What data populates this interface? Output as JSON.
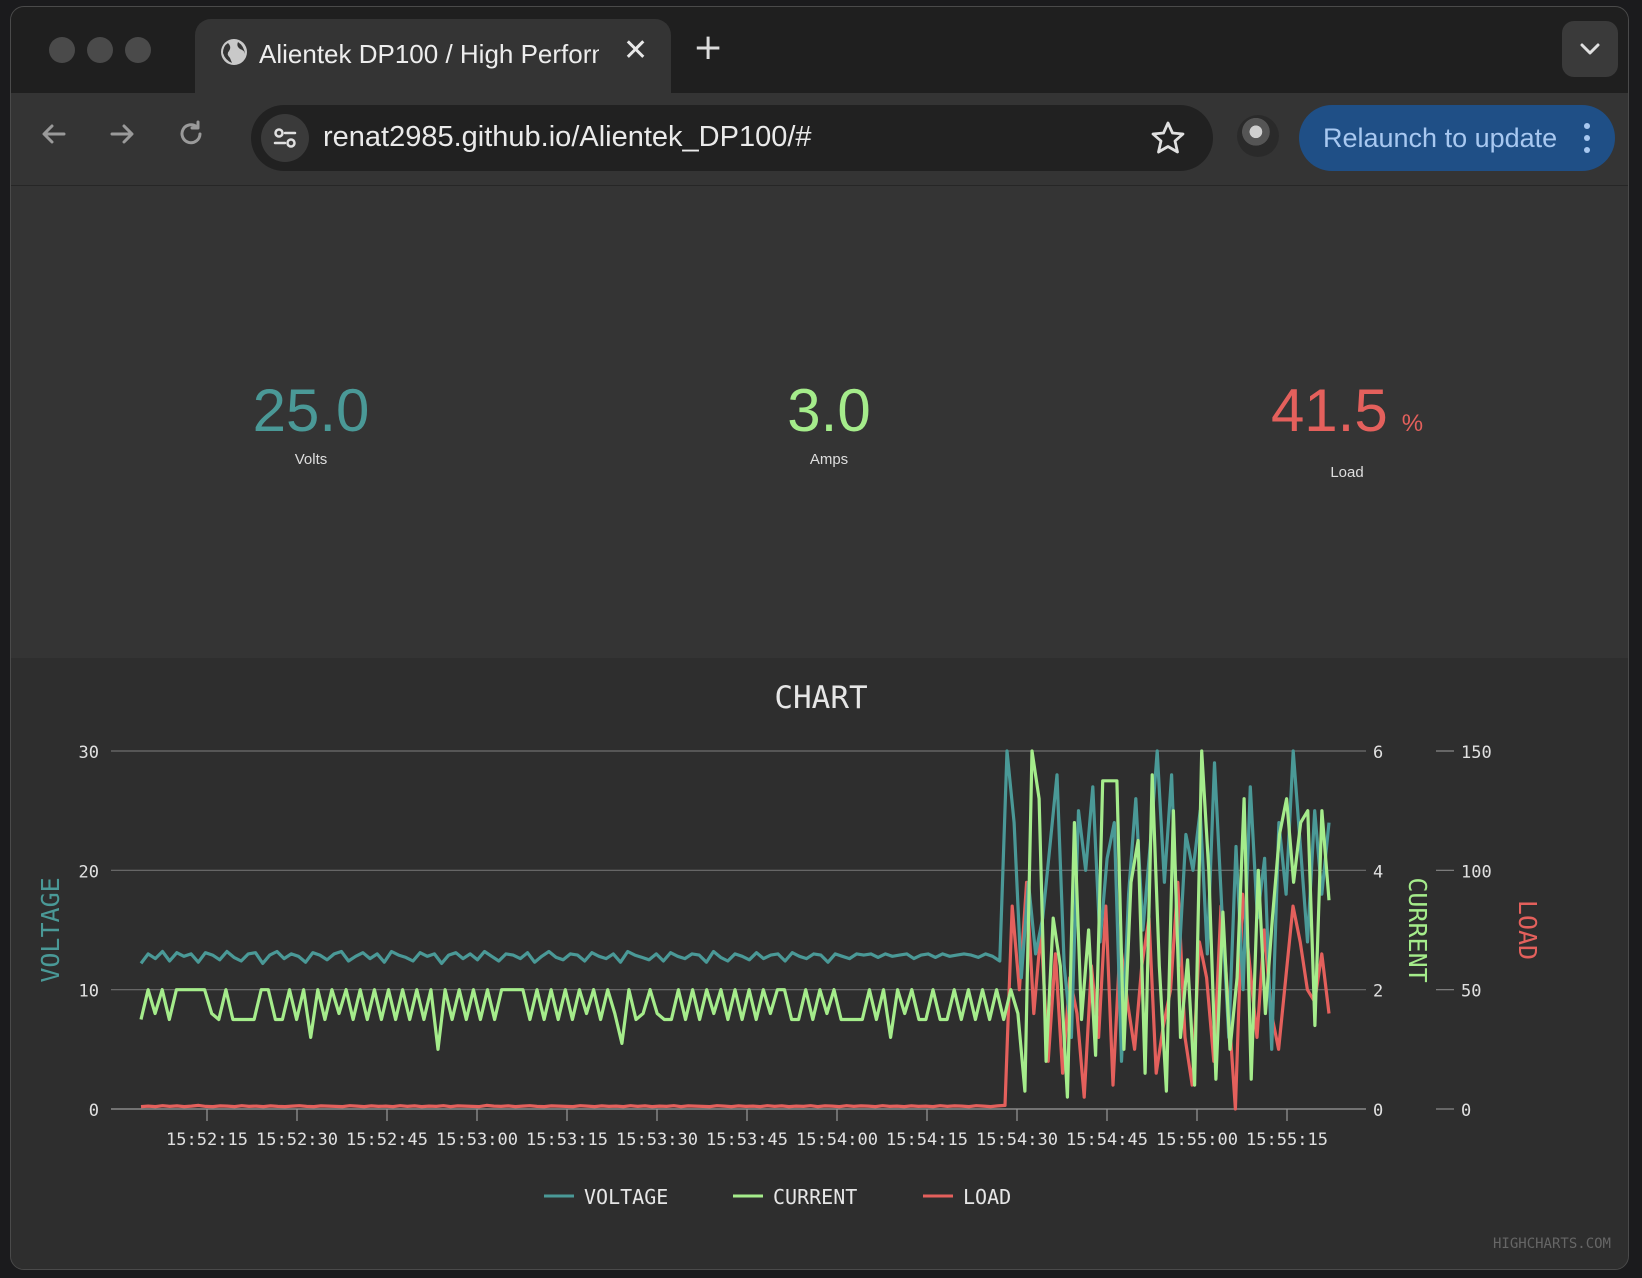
{
  "browser": {
    "tab_title": "Alientek DP100 / High Perform",
    "url": "renat2985.github.io/Alientek_DP100/#",
    "relaunch_label": "Relaunch to update"
  },
  "stats": {
    "voltage": {
      "value": "25.0",
      "label": "Volts"
    },
    "current": {
      "value": "3.0",
      "label": "Amps"
    },
    "load": {
      "value": "41.5",
      "unit": "%",
      "label": "Load"
    }
  },
  "colors": {
    "voltage": "#4a9997",
    "current": "#a5ec8b",
    "load": "#e4605c"
  },
  "chart_data": {
    "type": "line",
    "title": "CHART",
    "credit": "HIGHCHARTS.COM",
    "legend_position": "bottom",
    "grid": true,
    "x_tick_labels": [
      "15:52:15",
      "15:52:30",
      "15:52:45",
      "15:53:00",
      "15:53:15",
      "15:53:30",
      "15:53:45",
      "15:54:00",
      "15:54:15",
      "15:54:30",
      "15:54:45",
      "15:55:00",
      "15:55:15"
    ],
    "x_range_seconds": [
      "15:52:04",
      "15:55:22"
    ],
    "axes": [
      {
        "id": "voltage",
        "title": "VOLTAGE",
        "side": "left",
        "ylim": [
          0,
          30
        ],
        "ticks": [
          "0",
          "10",
          "20",
          "30"
        ]
      },
      {
        "id": "current",
        "title": "CURRENT",
        "side": "right",
        "ylim": [
          0,
          6
        ],
        "ticks": [
          "0",
          "2",
          "4",
          "6"
        ]
      },
      {
        "id": "load",
        "title": "LOAD",
        "side": "right",
        "ylim": [
          0,
          150
        ],
        "ticks": [
          "0",
          "50",
          "100",
          "150"
        ]
      }
    ],
    "series": [
      {
        "name": "VOLTAGE",
        "axis": "voltage",
        "color": "#4a9997",
        "values": [
          12.2,
          13.0,
          12.6,
          13.2,
          12.4,
          13.1,
          12.8,
          13.0,
          12.3,
          13.1,
          12.9,
          12.5,
          13.2,
          12.7,
          12.4,
          13.0,
          13.1,
          12.2,
          12.9,
          13.2,
          12.6,
          13.0,
          12.8,
          12.3,
          13.1,
          12.9,
          12.5,
          13.0,
          13.2,
          12.4,
          12.8,
          13.1,
          12.6,
          13.0,
          12.3,
          13.2,
          12.9,
          12.7,
          12.4,
          13.1,
          12.8,
          13.0,
          12.2,
          12.9,
          13.1,
          12.6,
          13.0,
          12.5,
          13.2,
          12.8,
          12.4,
          13.0,
          12.9,
          12.6,
          13.1,
          12.3,
          12.8,
          13.2,
          12.7,
          12.5,
          13.0,
          12.9,
          12.4,
          13.1,
          12.8,
          12.6,
          13.0,
          12.3,
          13.2,
          12.9,
          12.7,
          12.5,
          13.0,
          12.4,
          13.1,
          12.8,
          12.6,
          13.0,
          12.9,
          12.3,
          13.2,
          12.7,
          12.4,
          13.0,
          12.8,
          12.5,
          13.1,
          12.6,
          12.9,
          13.0,
          12.4,
          13.1,
          12.8,
          12.6,
          13.0,
          12.9,
          12.3,
          13.0,
          12.8,
          12.6,
          13.0,
          12.9,
          13.0,
          12.7,
          13.0,
          12.8,
          12.9,
          13.0,
          12.6,
          12.9,
          13.0,
          12.7,
          13.0,
          12.8,
          12.9,
          13.0,
          12.9,
          12.7,
          13.0,
          12.8,
          12.4,
          30.0,
          24.0,
          11.0,
          19.0,
          13.0,
          16.0,
          22.0,
          28.0,
          12.0,
          6.0,
          25.0,
          20.0,
          27.0,
          14.0,
          21.0,
          24.0,
          4.0,
          18.0,
          26.0,
          15.0,
          22.0,
          30.0,
          19.0,
          28.0,
          12.0,
          23.0,
          20.0,
          25.0,
          13.0,
          29.0,
          17.0,
          6.0,
          22.0,
          10.0,
          27.0,
          16.0,
          21.0,
          5.0,
          24.0,
          18.0,
          30.0,
          22.0,
          14.0,
          25.0,
          18.0,
          24.0
        ],
        "note": ""
      },
      {
        "name": "CURRENT",
        "axis": "current",
        "color": "#a5ec8b",
        "values": [
          1.5,
          2.0,
          1.6,
          2.0,
          1.5,
          2.0,
          2.0,
          2.0,
          2.0,
          2.0,
          1.6,
          1.5,
          2.0,
          1.5,
          1.5,
          1.5,
          1.5,
          2.0,
          2.0,
          1.5,
          1.5,
          2.0,
          1.5,
          2.0,
          1.2,
          2.0,
          1.5,
          2.0,
          1.6,
          2.0,
          1.5,
          2.0,
          1.5,
          2.0,
          1.5,
          2.0,
          1.5,
          2.0,
          1.5,
          2.0,
          1.5,
          2.0,
          1.0,
          2.0,
          1.5,
          2.0,
          1.5,
          2.0,
          1.5,
          2.0,
          1.5,
          2.0,
          2.0,
          2.0,
          2.0,
          1.5,
          2.0,
          1.5,
          2.0,
          1.5,
          2.0,
          1.5,
          2.0,
          1.6,
          2.0,
          1.5,
          2.0,
          1.6,
          1.1,
          2.0,
          1.5,
          1.6,
          2.0,
          1.6,
          1.5,
          1.5,
          2.0,
          1.5,
          2.0,
          1.5,
          2.0,
          1.6,
          2.0,
          1.5,
          2.0,
          1.5,
          2.0,
          1.5,
          2.0,
          1.6,
          2.0,
          2.0,
          1.5,
          1.5,
          2.0,
          1.5,
          2.0,
          1.6,
          2.0,
          1.5,
          1.5,
          1.5,
          1.5,
          2.0,
          1.5,
          2.0,
          1.2,
          2.0,
          1.6,
          2.0,
          1.5,
          1.5,
          2.0,
          1.5,
          1.5,
          2.0,
          1.5,
          2.0,
          1.5,
          2.0,
          1.5,
          2.0,
          1.5,
          2.0,
          1.6,
          0.3,
          6.0,
          5.2,
          0.8,
          3.2,
          2.4,
          0.2,
          4.8,
          1.5,
          3.0,
          0.9,
          5.5,
          5.5,
          5.5,
          1.0,
          3.8,
          4.5,
          0.6,
          5.6,
          2.4,
          0.3,
          5.0,
          1.2,
          2.5,
          0.4,
          6.0,
          4.0,
          0.5,
          3.3,
          1.0,
          2.2,
          5.2,
          0.5,
          4.0,
          1.6,
          3.2,
          4.6,
          5.2,
          3.8,
          4.8,
          5.0,
          1.4,
          5.0,
          3.5
        ],
        "note": ""
      },
      {
        "name": "LOAD",
        "axis": "load",
        "color": "#e4605c",
        "values": [
          1.0,
          1.2,
          1.0,
          1.4,
          1.1,
          1.3,
          1.0,
          1.2,
          1.5,
          1.1,
          1.0,
          1.3,
          1.2,
          1.0,
          1.4,
          1.1,
          1.2,
          1.0,
          1.3,
          1.1,
          1.0,
          1.2,
          1.4,
          1.1,
          1.0,
          1.3,
          1.2,
          1.1,
          1.0,
          1.4,
          1.2,
          1.0,
          1.3,
          1.1,
          1.2,
          1.0,
          1.4,
          1.1,
          1.3,
          1.0,
          1.2,
          1.1,
          1.4,
          1.0,
          1.3,
          1.2,
          1.1,
          1.0,
          1.5,
          1.2,
          1.1,
          1.3,
          1.0,
          1.2,
          1.4,
          1.1,
          1.0,
          1.3,
          1.2,
          1.1,
          1.0,
          1.4,
          1.2,
          1.0,
          1.3,
          1.1,
          1.2,
          1.0,
          1.4,
          1.1,
          1.3,
          1.0,
          1.2,
          1.1,
          1.4,
          1.0,
          1.3,
          1.2,
          1.1,
          1.0,
          1.4,
          1.2,
          1.0,
          1.3,
          1.1,
          1.2,
          1.0,
          1.4,
          1.1,
          1.3,
          1.0,
          1.2,
          1.1,
          1.4,
          1.0,
          1.3,
          1.2,
          1.0,
          1.4,
          1.1,
          1.3,
          1.2,
          1.0,
          1.4,
          1.1,
          1.2,
          1.0,
          1.3,
          1.1,
          1.2,
          1.0,
          1.4,
          1.1,
          1.3,
          1.2,
          1.0,
          1.4,
          1.2,
          1.0,
          1.3,
          1.5,
          85.0,
          50.0,
          95.0,
          40.0,
          75.0,
          20.0,
          65.0,
          15.0,
          55.0,
          40.0,
          5.0,
          60.0,
          30.0,
          85.0,
          10.0,
          70.0,
          45.0,
          25.0,
          60.0,
          80.0,
          15.0,
          35.0,
          50.0,
          95.0,
          30.0,
          10.0,
          70.0,
          55.0,
          20.0,
          85.0,
          45.0,
          0.0,
          90.0,
          60.0,
          30.0,
          75.0,
          40.0,
          25.0,
          55.0,
          85.0,
          70.0,
          50.0,
          45.0,
          65.0,
          40.0
        ],
        "note": ""
      }
    ]
  },
  "legend": [
    {
      "name": "VOLTAGE",
      "color": "#4a9997"
    },
    {
      "name": "CURRENT",
      "color": "#a5ec8b"
    },
    {
      "name": "LOAD",
      "color": "#e4605c"
    }
  ]
}
